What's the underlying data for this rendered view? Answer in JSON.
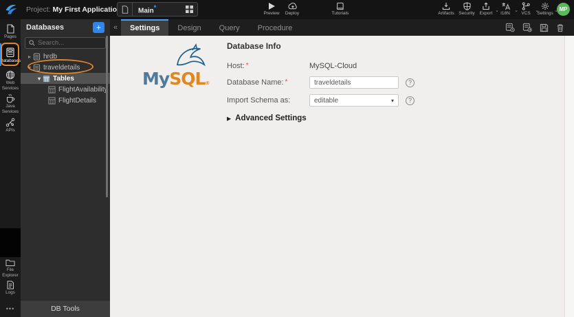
{
  "topbar": {
    "project_label": "Project:",
    "project_name": "My First Application",
    "page_selector": {
      "name": "Main",
      "dirty_mark": "*"
    },
    "actions": {
      "preview": "Preview",
      "deploy": "Deploy",
      "tutorials": "Tutorials",
      "artifacts": "Artifacts",
      "security": "Security",
      "export": "Export",
      "i18n": "I18N",
      "vcs": "VCS",
      "settings": "Settings"
    },
    "avatar_initials": "MP"
  },
  "sidebar": {
    "items": [
      {
        "label": "Pages"
      },
      {
        "label": "Databases",
        "active": true
      },
      {
        "label": "Web Services"
      },
      {
        "label": "Java Services"
      },
      {
        "label": "APIs"
      },
      {
        "label": "File Explorer"
      },
      {
        "label": "Logs"
      }
    ],
    "more": "•••"
  },
  "panel": {
    "title": "Databases",
    "add_label": "+",
    "search_placeholder": "Search...",
    "collapse_glyph": "«",
    "tree": [
      {
        "label": "hrdb",
        "type": "database",
        "caret": "▸"
      },
      {
        "label": "traveldetails",
        "type": "database",
        "caret": "▾",
        "annotated": true
      },
      {
        "label": "Tables",
        "type": "tables-folder",
        "caret": "▾",
        "selected": true
      },
      {
        "label": "FlightAvailability",
        "type": "table"
      },
      {
        "label": "FlightDetails",
        "type": "table"
      }
    ],
    "footer": "DB Tools"
  },
  "tabs": {
    "items": [
      "Settings",
      "Design",
      "Query",
      "Procedure"
    ],
    "active": "Settings"
  },
  "content": {
    "logo": {
      "my": "My",
      "sql": "SQL",
      "registered": "®"
    },
    "section_title": "Database Info",
    "required_mark": "*",
    "fields": {
      "host": {
        "label": "Host:",
        "value": "MySQL-Cloud"
      },
      "db_name": {
        "label": "Database Name:",
        "value": "traveldetails"
      },
      "import_schema": {
        "label": "Import Schema as:",
        "value": "editable"
      }
    },
    "advanced_label": "Advanced Settings",
    "help_glyph": "?"
  },
  "colors": {
    "accent_blue": "#2f86eb",
    "active_tab_blue": "#4aa0f5",
    "annotation_orange": "#e0862c",
    "avatar_green": "#5cb85c",
    "mysql_blue": "#4f7a9b",
    "mysql_orange": "#e0871f",
    "required_red": "#d9534f"
  }
}
